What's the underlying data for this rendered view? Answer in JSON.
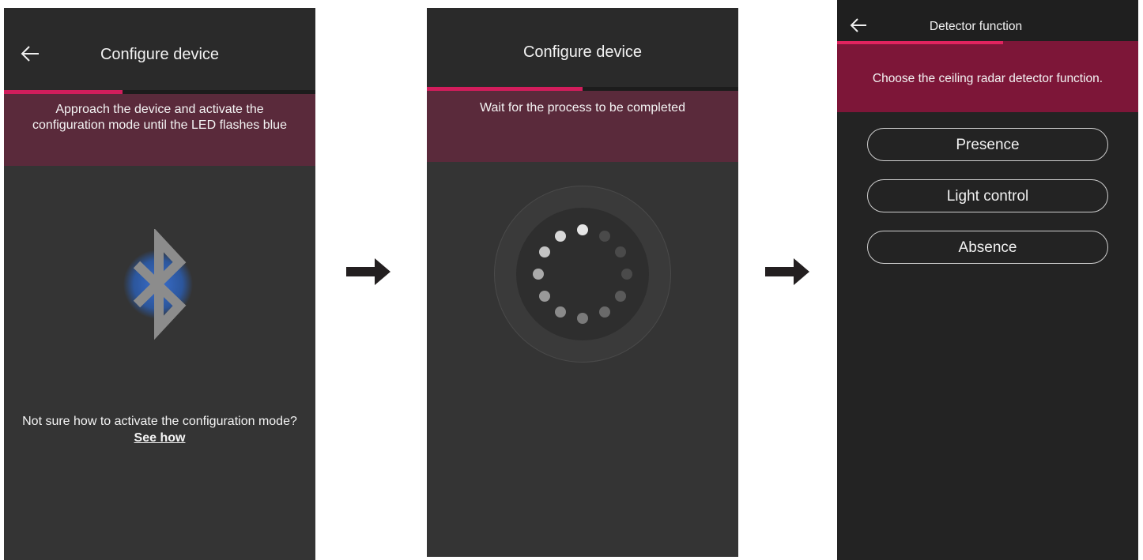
{
  "screen1": {
    "title": "Configure device",
    "banner_line1": "Approach the device and activate the",
    "banner_line2": "configuration mode until the LED flashes blue",
    "help_text": "Not sure how to activate the configuration mode? ",
    "help_link": "See how",
    "icons": {
      "back": "back-arrow-icon",
      "device": "bluetooth-icon"
    },
    "progress": 0.38
  },
  "screen2": {
    "title": "Configure device",
    "banner": "Wait for the process to be completed",
    "icons": {
      "loading": "loading-spinner-icon"
    },
    "progress": 0.5
  },
  "screen3": {
    "title": "Detector function",
    "banner": "Choose the ceiling radar detector function.",
    "options": [
      "Presence",
      "Light control",
      "Absence"
    ],
    "icons": {
      "back": "back-arrow-icon"
    },
    "progress": 0.55
  },
  "colors": {
    "accent": "#d21d5c",
    "banner": "#5a2a3b",
    "banner_active": "#7d1638",
    "bluetooth_glow": "#2b5aa8"
  }
}
